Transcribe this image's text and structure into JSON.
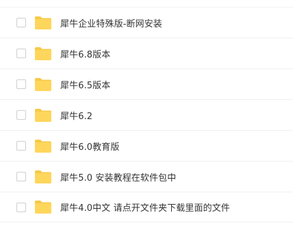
{
  "colors": {
    "folder": "#ffd65c",
    "folder_tab": "#f7c948",
    "text": "#333333",
    "checkbox_border": "#cfcfcf",
    "divider": "#f0f0f0"
  },
  "files": [
    {
      "name": "犀牛企业特殊版-断网安装",
      "icon": "folder-icon",
      "checked": false
    },
    {
      "name": "犀牛6.8版本",
      "icon": "folder-icon",
      "checked": false
    },
    {
      "name": "犀牛6.5版本",
      "icon": "folder-icon",
      "checked": false
    },
    {
      "name": "犀牛6.2",
      "icon": "folder-icon",
      "checked": false
    },
    {
      "name": "犀牛6.0教育版",
      "icon": "folder-icon",
      "checked": false
    },
    {
      "name": "犀牛5.0 安装教程在软件包中",
      "icon": "folder-icon",
      "checked": false
    },
    {
      "name": "犀牛4.0中文 请点开文件夹下载里面的文件",
      "icon": "folder-icon",
      "checked": false
    }
  ]
}
